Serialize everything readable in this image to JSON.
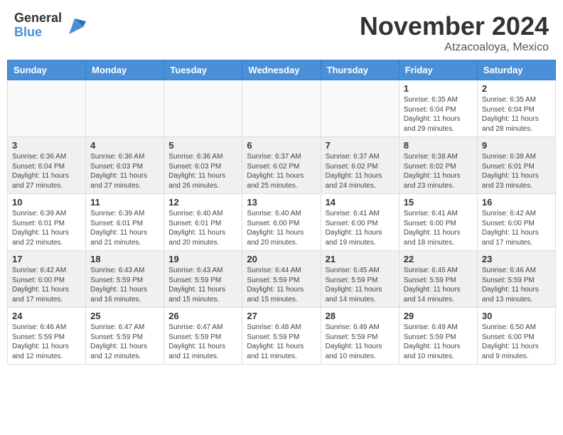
{
  "header": {
    "logo_general": "General",
    "logo_blue": "Blue",
    "month_title": "November 2024",
    "location": "Atzacoaloya, Mexico"
  },
  "days_of_week": [
    "Sunday",
    "Monday",
    "Tuesday",
    "Wednesday",
    "Thursday",
    "Friday",
    "Saturday"
  ],
  "weeks": [
    [
      {
        "day": "",
        "info": ""
      },
      {
        "day": "",
        "info": ""
      },
      {
        "day": "",
        "info": ""
      },
      {
        "day": "",
        "info": ""
      },
      {
        "day": "",
        "info": ""
      },
      {
        "day": "1",
        "info": "Sunrise: 6:35 AM\nSunset: 6:04 PM\nDaylight: 11 hours and 29 minutes."
      },
      {
        "day": "2",
        "info": "Sunrise: 6:35 AM\nSunset: 6:04 PM\nDaylight: 11 hours and 28 minutes."
      }
    ],
    [
      {
        "day": "3",
        "info": "Sunrise: 6:36 AM\nSunset: 6:04 PM\nDaylight: 11 hours and 27 minutes."
      },
      {
        "day": "4",
        "info": "Sunrise: 6:36 AM\nSunset: 6:03 PM\nDaylight: 11 hours and 27 minutes."
      },
      {
        "day": "5",
        "info": "Sunrise: 6:36 AM\nSunset: 6:03 PM\nDaylight: 11 hours and 26 minutes."
      },
      {
        "day": "6",
        "info": "Sunrise: 6:37 AM\nSunset: 6:02 PM\nDaylight: 11 hours and 25 minutes."
      },
      {
        "day": "7",
        "info": "Sunrise: 6:37 AM\nSunset: 6:02 PM\nDaylight: 11 hours and 24 minutes."
      },
      {
        "day": "8",
        "info": "Sunrise: 6:38 AM\nSunset: 6:02 PM\nDaylight: 11 hours and 23 minutes."
      },
      {
        "day": "9",
        "info": "Sunrise: 6:38 AM\nSunset: 6:01 PM\nDaylight: 11 hours and 23 minutes."
      }
    ],
    [
      {
        "day": "10",
        "info": "Sunrise: 6:39 AM\nSunset: 6:01 PM\nDaylight: 11 hours and 22 minutes."
      },
      {
        "day": "11",
        "info": "Sunrise: 6:39 AM\nSunset: 6:01 PM\nDaylight: 11 hours and 21 minutes."
      },
      {
        "day": "12",
        "info": "Sunrise: 6:40 AM\nSunset: 6:01 PM\nDaylight: 11 hours and 20 minutes."
      },
      {
        "day": "13",
        "info": "Sunrise: 6:40 AM\nSunset: 6:00 PM\nDaylight: 11 hours and 20 minutes."
      },
      {
        "day": "14",
        "info": "Sunrise: 6:41 AM\nSunset: 6:00 PM\nDaylight: 11 hours and 19 minutes."
      },
      {
        "day": "15",
        "info": "Sunrise: 6:41 AM\nSunset: 6:00 PM\nDaylight: 11 hours and 18 minutes."
      },
      {
        "day": "16",
        "info": "Sunrise: 6:42 AM\nSunset: 6:00 PM\nDaylight: 11 hours and 17 minutes."
      }
    ],
    [
      {
        "day": "17",
        "info": "Sunrise: 6:42 AM\nSunset: 6:00 PM\nDaylight: 11 hours and 17 minutes."
      },
      {
        "day": "18",
        "info": "Sunrise: 6:43 AM\nSunset: 5:59 PM\nDaylight: 11 hours and 16 minutes."
      },
      {
        "day": "19",
        "info": "Sunrise: 6:43 AM\nSunset: 5:59 PM\nDaylight: 11 hours and 15 minutes."
      },
      {
        "day": "20",
        "info": "Sunrise: 6:44 AM\nSunset: 5:59 PM\nDaylight: 11 hours and 15 minutes."
      },
      {
        "day": "21",
        "info": "Sunrise: 6:45 AM\nSunset: 5:59 PM\nDaylight: 11 hours and 14 minutes."
      },
      {
        "day": "22",
        "info": "Sunrise: 6:45 AM\nSunset: 5:59 PM\nDaylight: 11 hours and 14 minutes."
      },
      {
        "day": "23",
        "info": "Sunrise: 6:46 AM\nSunset: 5:59 PM\nDaylight: 11 hours and 13 minutes."
      }
    ],
    [
      {
        "day": "24",
        "info": "Sunrise: 6:46 AM\nSunset: 5:59 PM\nDaylight: 11 hours and 12 minutes."
      },
      {
        "day": "25",
        "info": "Sunrise: 6:47 AM\nSunset: 5:59 PM\nDaylight: 11 hours and 12 minutes."
      },
      {
        "day": "26",
        "info": "Sunrise: 6:47 AM\nSunset: 5:59 PM\nDaylight: 11 hours and 11 minutes."
      },
      {
        "day": "27",
        "info": "Sunrise: 6:48 AM\nSunset: 5:59 PM\nDaylight: 11 hours and 11 minutes."
      },
      {
        "day": "28",
        "info": "Sunrise: 6:49 AM\nSunset: 5:59 PM\nDaylight: 11 hours and 10 minutes."
      },
      {
        "day": "29",
        "info": "Sunrise: 6:49 AM\nSunset: 5:59 PM\nDaylight: 11 hours and 10 minutes."
      },
      {
        "day": "30",
        "info": "Sunrise: 6:50 AM\nSunset: 6:00 PM\nDaylight: 11 hours and 9 minutes."
      }
    ]
  ]
}
